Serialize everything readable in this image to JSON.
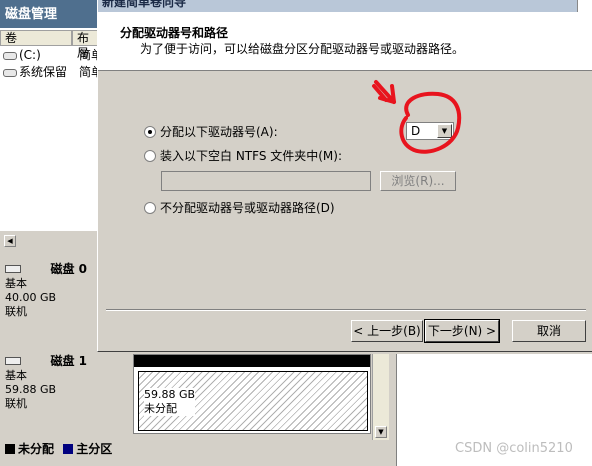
{
  "disk_management": {
    "title": "磁盘管理",
    "columns": [
      "卷",
      "布局"
    ],
    "volumes": [
      {
        "name": "(C:)",
        "layout": "简单"
      },
      {
        "name": "系统保留",
        "layout": "简单"
      }
    ],
    "disks": [
      {
        "name": "磁盘 0",
        "type": "基本",
        "size": "40.00 GB",
        "status": "联机"
      },
      {
        "name": "磁盘 1",
        "type": "基本",
        "size": "59.88 GB",
        "status": "联机"
      }
    ],
    "disk1_partition": {
      "size": "59.88 GB",
      "status": "未分配"
    },
    "legend": [
      {
        "label": "未分配",
        "color": "#000000"
      },
      {
        "label": "主分区",
        "color": "#00007f"
      }
    ]
  },
  "wizard": {
    "window_title": "新建简单卷向导",
    "header_title": "分配驱动器号和路径",
    "header_subtitle": "为了便于访问，可以给磁盘分区分配驱动器号或驱动器路径。",
    "options": [
      {
        "label": "分配以下驱动器号(A):",
        "selected": true
      },
      {
        "label": "装入以下空白 NTFS 文件夹中(M):",
        "selected": false
      },
      {
        "label": "不分配驱动器号或驱动器路径(D)",
        "selected": false
      }
    ],
    "drive_letter": "D",
    "folder_path": "",
    "browse_label": "浏览(R)...",
    "back_label": "< 上一步(B)",
    "next_label": "下一步(N) >",
    "cancel_label": "取消"
  },
  "annotation_color": "#e8141e",
  "watermark": "CSDN @colin5210"
}
